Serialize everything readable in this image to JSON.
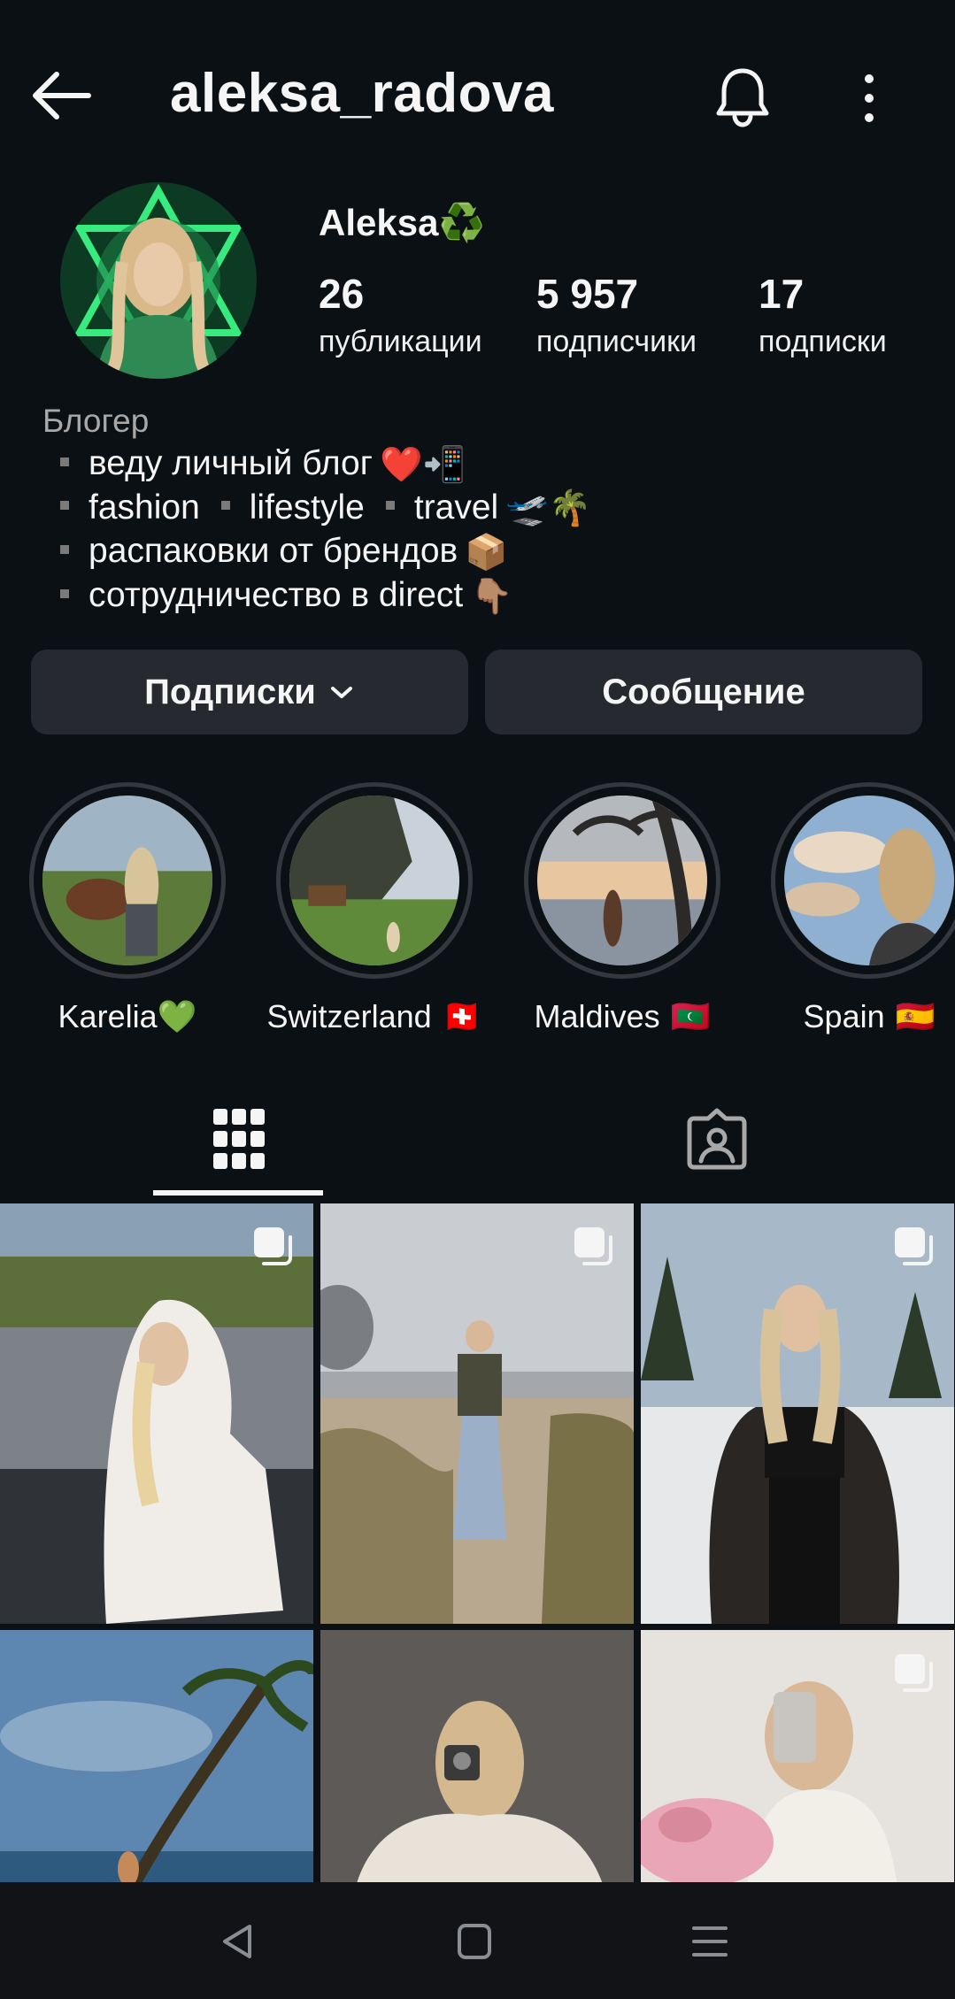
{
  "header": {
    "username": "aleksa_radova",
    "icons": [
      "back-arrow-icon",
      "bell-icon",
      "more-vertical-icon"
    ]
  },
  "profile": {
    "display_name": "Aleksa",
    "name_emoji": "♻️",
    "stats": [
      {
        "value": "26",
        "label": "публикации"
      },
      {
        "value": "5 957",
        "label": "подписчики"
      },
      {
        "value": "17",
        "label": "подписки"
      }
    ]
  },
  "bio": {
    "category": "Блогер",
    "line1": {
      "text": "веду личный блог",
      "emoji": "❤️📲"
    },
    "line2": {
      "a": "fashion",
      "b": "lifestyle",
      "c": "travel",
      "emoji": "🛫🌴"
    },
    "line3": {
      "text": "распаковки от брендов",
      "emoji": "📦"
    },
    "line4": {
      "text": "сотрудничество в direct",
      "emoji": "👇🏽"
    }
  },
  "buttons": {
    "follow_label": "Подписки",
    "message_label": "Сообщение"
  },
  "highlights": [
    {
      "label": "Karelia",
      "emoji": "💚"
    },
    {
      "label": "Switzerland",
      "emoji": "🇨🇭"
    },
    {
      "label": "Maldives",
      "emoji": "🇲🇻"
    },
    {
      "label": "Spain",
      "emoji": "🇪🇸"
    }
  ],
  "tabs": [
    "grid-icon",
    "tagged-icon"
  ],
  "posts": [
    {
      "carousel": true
    },
    {
      "carousel": true
    },
    {
      "carousel": true
    },
    {
      "carousel": false
    },
    {
      "carousel": false
    },
    {
      "carousel": true
    }
  ],
  "colors": {
    "background": "#0b1014",
    "button": "#262a30",
    "text": "#f5f5f5",
    "secondary_text": "#a8a8a8"
  }
}
